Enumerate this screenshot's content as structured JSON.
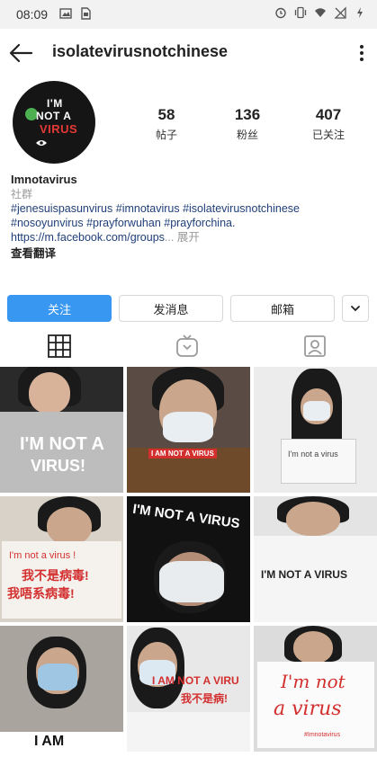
{
  "status_bar": {
    "time": "08:09",
    "icons": [
      "image-icon",
      "sim-icon",
      "alarm-icon",
      "vibrate-icon",
      "wifi-icon",
      "signal-off-icon",
      "battery-charging-icon"
    ]
  },
  "header": {
    "username": "isolatevirusnotchinese",
    "back_icon": "back-arrow-icon",
    "menu_icon": "more-vertical-icon"
  },
  "avatar": {
    "line1": "I'M",
    "line2": "NOT A",
    "line3": "VIRUS"
  },
  "stats": [
    {
      "value": "58",
      "label": "帖子"
    },
    {
      "value": "136",
      "label": "粉丝"
    },
    {
      "value": "407",
      "label": "已关注"
    }
  ],
  "bio": {
    "name": "Imnotavirus",
    "category": "社群",
    "tags_line1": "#jenesuispasunvirus #imnotavirus #isolatevirusnotchinese",
    "tags_line2": "#nosoyunvirus #prayforwuhan #prayforchina.",
    "link": "https://m.facebook.com/groups",
    "more": "... 展开",
    "translate": "查看翻译"
  },
  "actions": {
    "follow": "关注",
    "message": "发消息",
    "email": "邮箱"
  },
  "tabs": [
    "grid-icon",
    "igtv-icon",
    "tagged-icon"
  ],
  "grid_signs": {
    "t1": "I'M NOT A",
    "t1b": "VIRUS!",
    "t2": "I AM NOT A VIRUS",
    "t3a": "I'm not a virus",
    "t4a": "I'm not a virus !",
    "t4b": "我不是病毒!",
    "t4c": "我唔系病毒!",
    "t5": "I'M NOT A VIRUS",
    "t6": "I'M NOT A VIRUS",
    "t7": "I AM",
    "t8a": "I AM NOT A VIRU",
    "t8b": "我不是病!",
    "t9a": "I'm not",
    "t9b": "a virus",
    "t9c": "#Imnotavirus"
  },
  "colors": {
    "accent": "#3897f0",
    "link": "#1f3f7a",
    "sign_red": "#d32f2f"
  }
}
